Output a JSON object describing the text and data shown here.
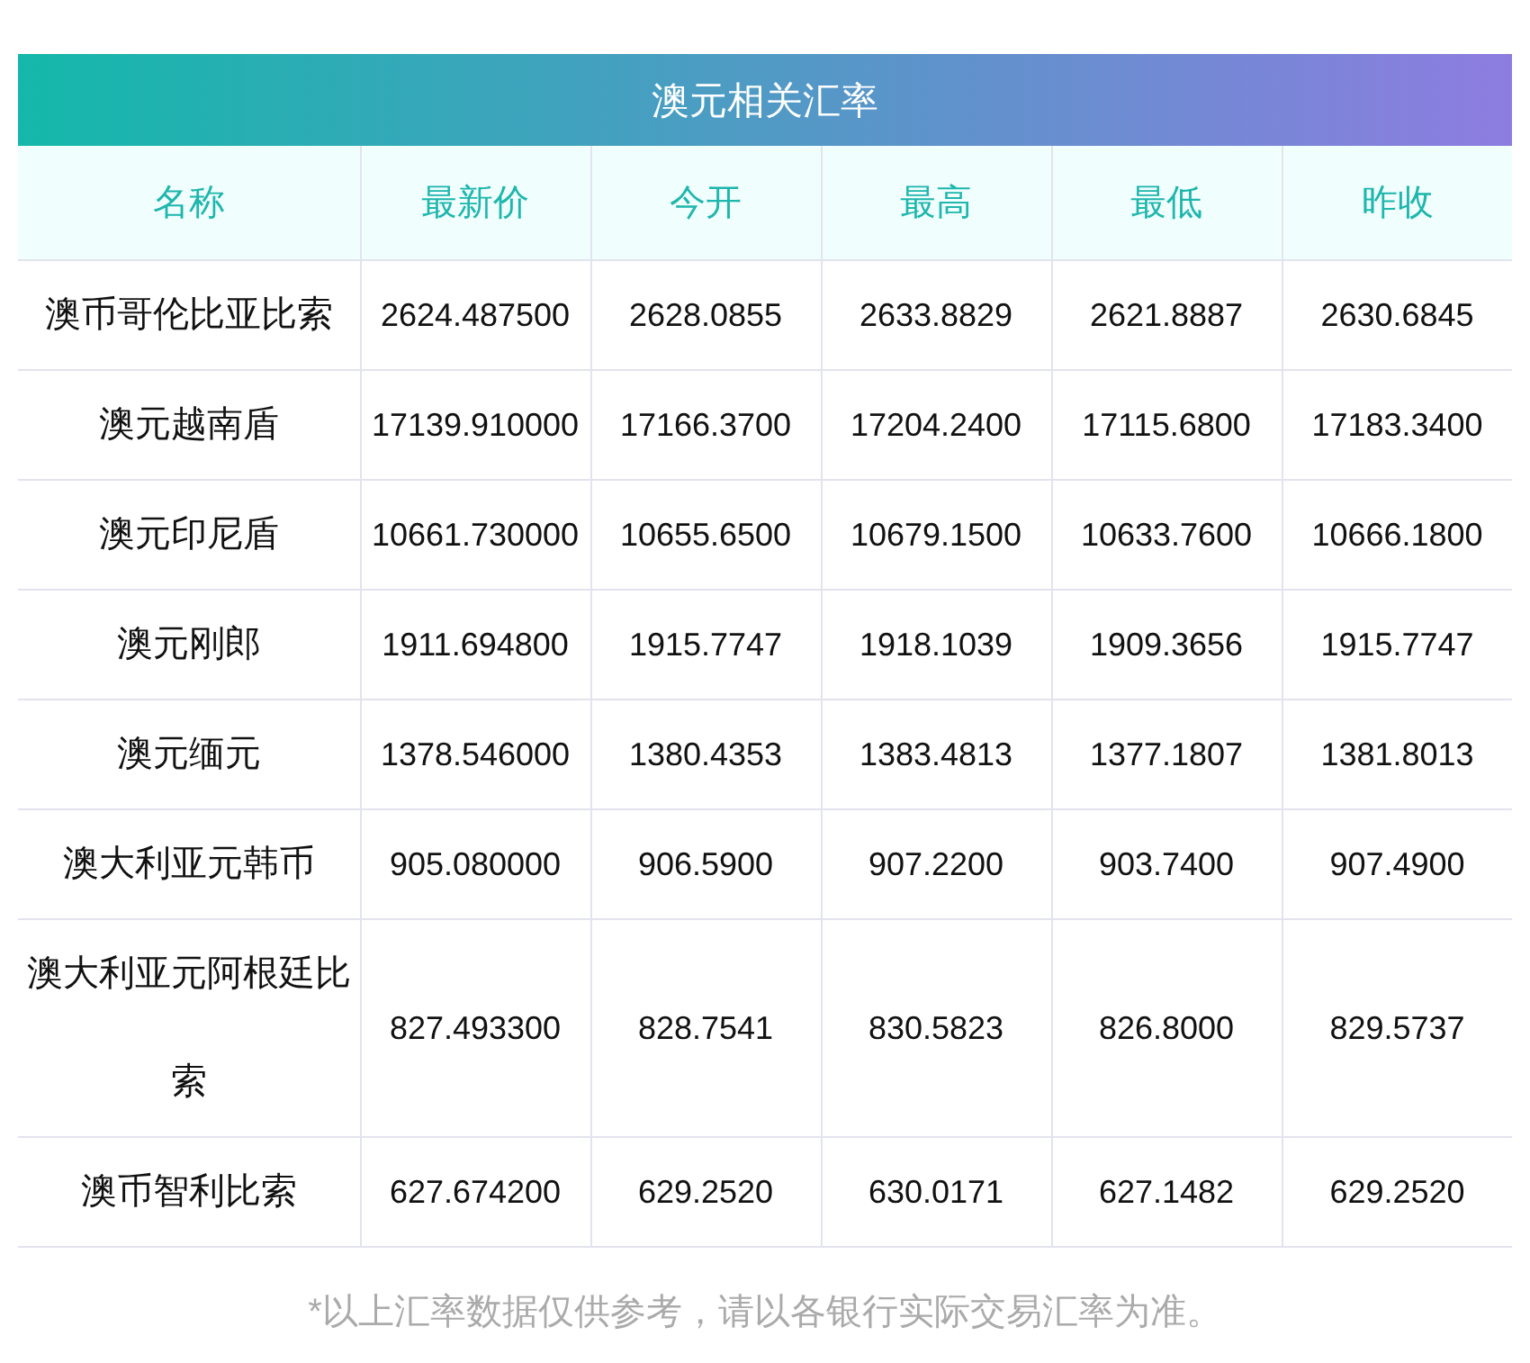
{
  "table": {
    "title": "澳元相关汇率",
    "columns": [
      "名称",
      "最新价",
      "今开",
      "最高",
      "最低",
      "昨收"
    ],
    "rows": [
      [
        "澳币哥伦比亚比索",
        "2624.487500",
        "2628.0855",
        "2633.8829",
        "2621.8887",
        "2630.6845"
      ],
      [
        "澳元越南盾",
        "17139.910000",
        "17166.3700",
        "17204.2400",
        "17115.6800",
        "17183.3400"
      ],
      [
        "澳元印尼盾",
        "10661.730000",
        "10655.6500",
        "10679.1500",
        "10633.7600",
        "10666.1800"
      ],
      [
        "澳元刚郎",
        "1911.694800",
        "1915.7747",
        "1918.1039",
        "1909.3656",
        "1915.7747"
      ],
      [
        "澳元缅元",
        "1378.546000",
        "1380.4353",
        "1383.4813",
        "1377.1807",
        "1381.8013"
      ],
      [
        "澳大利亚元韩币",
        "905.080000",
        "906.5900",
        "907.2200",
        "903.7400",
        "907.4900"
      ],
      [
        "澳大利亚元阿根廷比索",
        "827.493300",
        "828.7541",
        "830.5823",
        "826.8000",
        "829.5737"
      ],
      [
        "澳币智利比索",
        "627.674200",
        "629.2520",
        "630.0171",
        "627.1482",
        "629.2520"
      ]
    ]
  },
  "footnote": "*以上汇率数据仅供参考，请以各银行实际交易汇率为准。"
}
